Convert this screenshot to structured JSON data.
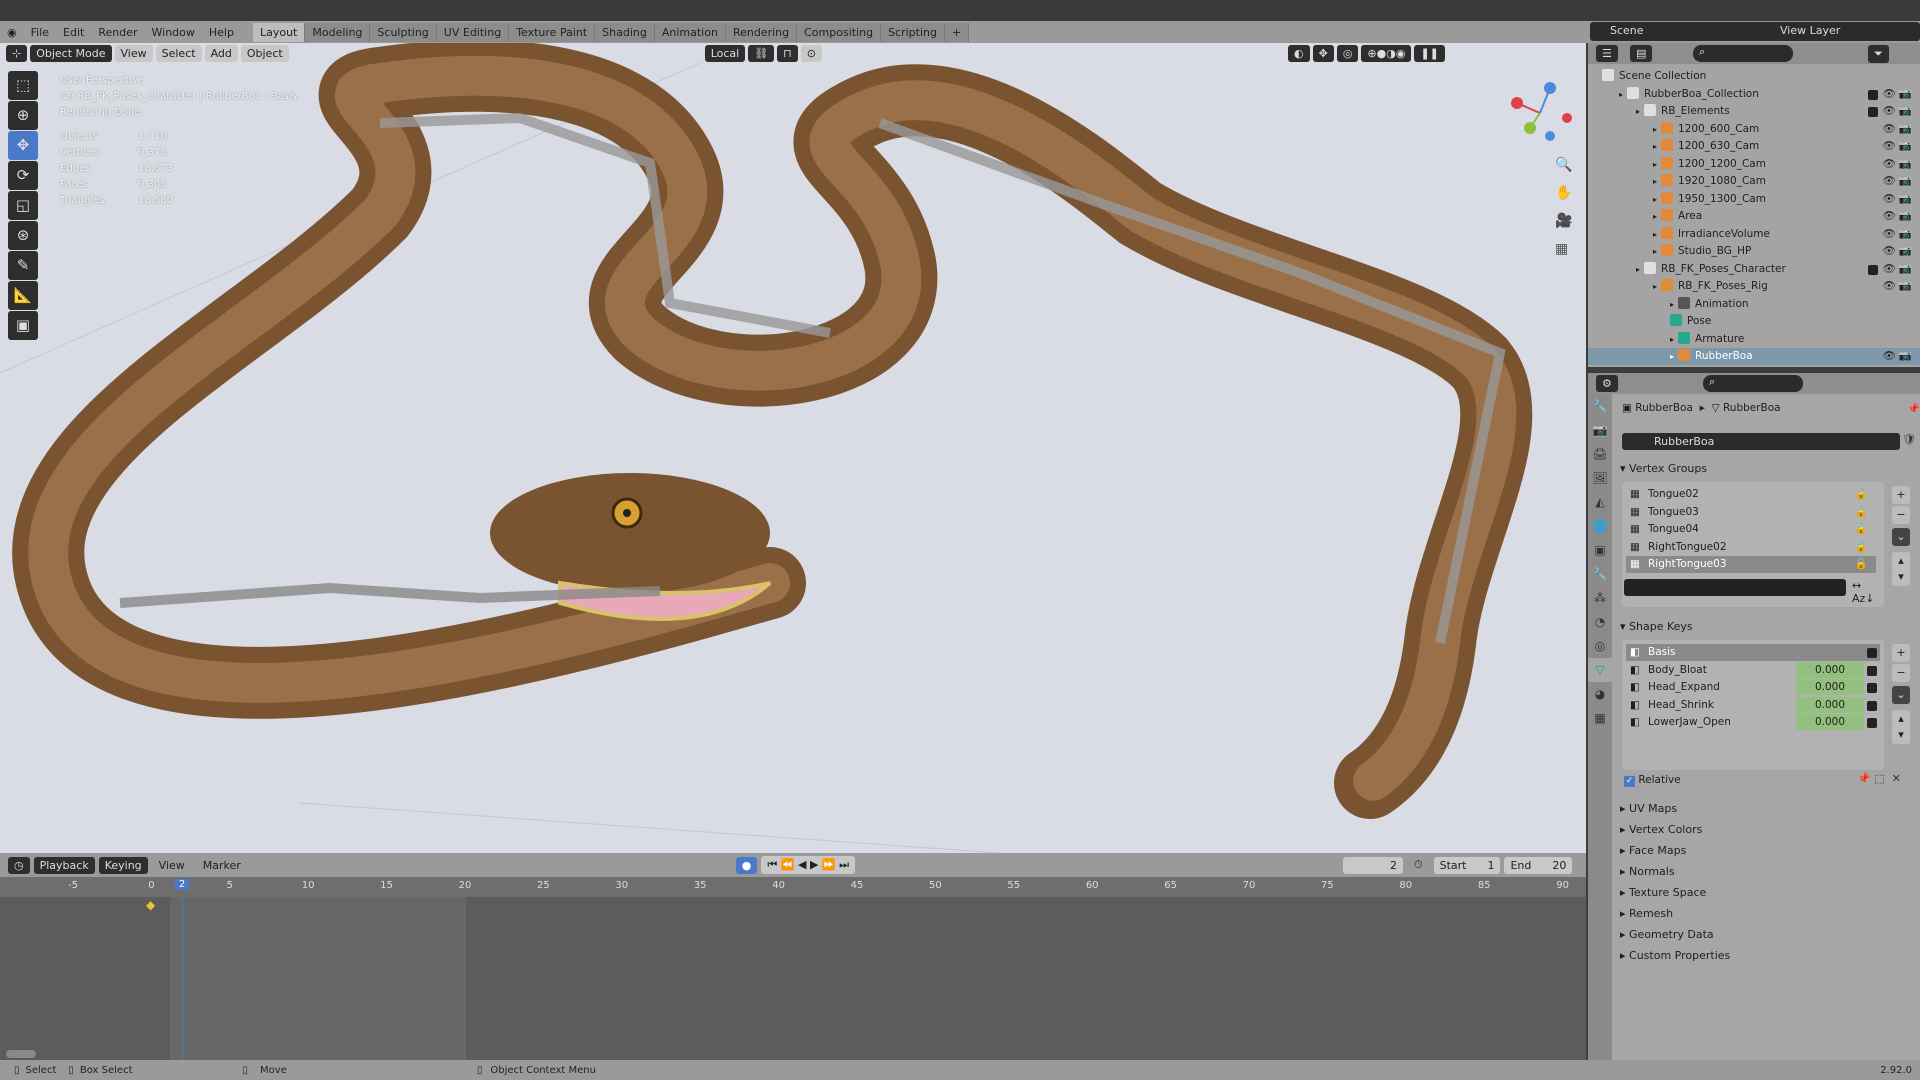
{
  "menu": [
    "File",
    "Edit",
    "Render",
    "Window",
    "Help"
  ],
  "workspaces": [
    "Layout",
    "Modeling",
    "Sculpting",
    "UV Editing",
    "Texture Paint",
    "Shading",
    "Animation",
    "Rendering",
    "Compositing",
    "Scripting",
    "+"
  ],
  "scene": "Scene",
  "view_layer": "View Layer",
  "viewport": {
    "mode": "Object Mode",
    "menus": [
      "View",
      "Select",
      "Add",
      "Object"
    ],
    "orientation": "Local",
    "overlay": {
      "title": "User Perspective",
      "context": "(2) RB_FK_Poses_Character | RubberBoa : Basis",
      "status": "Rendering Done",
      "stats": [
        [
          "Objects",
          "1 / 10"
        ],
        [
          "Vertices",
          "9,375"
        ],
        [
          "Edges",
          "18,673"
        ],
        [
          "Faces",
          "9,305"
        ],
        [
          "Triangles",
          "18,580"
        ]
      ]
    }
  },
  "timeline": {
    "menus": [
      "Playback",
      "Keying",
      "View",
      "Marker"
    ],
    "current_frame": "2",
    "start_label": "Start",
    "start": "1",
    "end_label": "End",
    "end": "20",
    "ticks": [
      "-5",
      "0",
      "5",
      "10",
      "15",
      "20",
      "25",
      "30",
      "35",
      "40",
      "45",
      "50",
      "55",
      "60",
      "65",
      "70",
      "75",
      "80",
      "85",
      "90"
    ]
  },
  "status": {
    "select": "Select",
    "box_select": "Box Select",
    "move": "Move",
    "context_menu": "Object Context Menu",
    "version": "2.92.0"
  },
  "outliner": [
    {
      "label": "Scene Collection",
      "depth": 0,
      "color": "#e0e0e0"
    },
    {
      "label": "RubberBoa_Collection",
      "depth": 1,
      "color": "#e0e0e0",
      "check": true
    },
    {
      "label": "RB_Elements",
      "depth": 2,
      "color": "#e0e0e0",
      "check": true
    },
    {
      "label": "1200_600_Cam",
      "depth": 3,
      "color": "#e08a3a"
    },
    {
      "label": "1200_630_Cam",
      "depth": 3,
      "color": "#e08a3a"
    },
    {
      "label": "1200_1200_Cam",
      "depth": 3,
      "color": "#e08a3a"
    },
    {
      "label": "1920_1080_Cam",
      "depth": 3,
      "color": "#e08a3a"
    },
    {
      "label": "1950_1300_Cam",
      "depth": 3,
      "color": "#e08a3a"
    },
    {
      "label": "Area",
      "depth": 3,
      "color": "#e08a3a"
    },
    {
      "label": "IrradianceVolume",
      "depth": 3,
      "color": "#e08a3a"
    },
    {
      "label": "Studio_BG_HP",
      "depth": 3,
      "color": "#e08a3a"
    },
    {
      "label": "RB_FK_Poses_Character",
      "depth": 2,
      "color": "#e0e0e0",
      "check": true
    },
    {
      "label": "RB_FK_Poses_Rig",
      "depth": 3,
      "color": "#e08a3a"
    },
    {
      "label": "Animation",
      "depth": 4,
      "color": "#555",
      "noeye": true
    },
    {
      "label": "Pose",
      "depth": 4,
      "color": "#27a88a",
      "noeye": true
    },
    {
      "label": "Armature",
      "depth": 4,
      "color": "#27a88a",
      "noeye": true
    },
    {
      "label": "RubberBoa",
      "depth": 4,
      "color": "#e08a3a",
      "selected": true
    }
  ],
  "properties": {
    "breadcrumb": [
      "RubberBoa",
      "RubberBoa"
    ],
    "mesh_name": "RubberBoa",
    "vertex_groups_title": "Vertex Groups",
    "vertex_groups": [
      "Tongue02",
      "Tongue03",
      "Tongue04",
      "RightTongue02",
      "RightTongue03"
    ],
    "shape_keys_title": "Shape Keys",
    "shape_keys": [
      {
        "name": "Basis",
        "value": ""
      },
      {
        "name": "Body_Bloat",
        "value": "0.000"
      },
      {
        "name": "Head_Expand",
        "value": "0.000"
      },
      {
        "name": "Head_Shrink",
        "value": "0.000"
      },
      {
        "name": "LowerJaw_Open",
        "value": "0.000"
      }
    ],
    "relative": "Relative",
    "panels": [
      "UV Maps",
      "Vertex Colors",
      "Face Maps",
      "Normals",
      "Texture Space",
      "Remesh",
      "Geometry Data",
      "Custom Properties"
    ]
  }
}
